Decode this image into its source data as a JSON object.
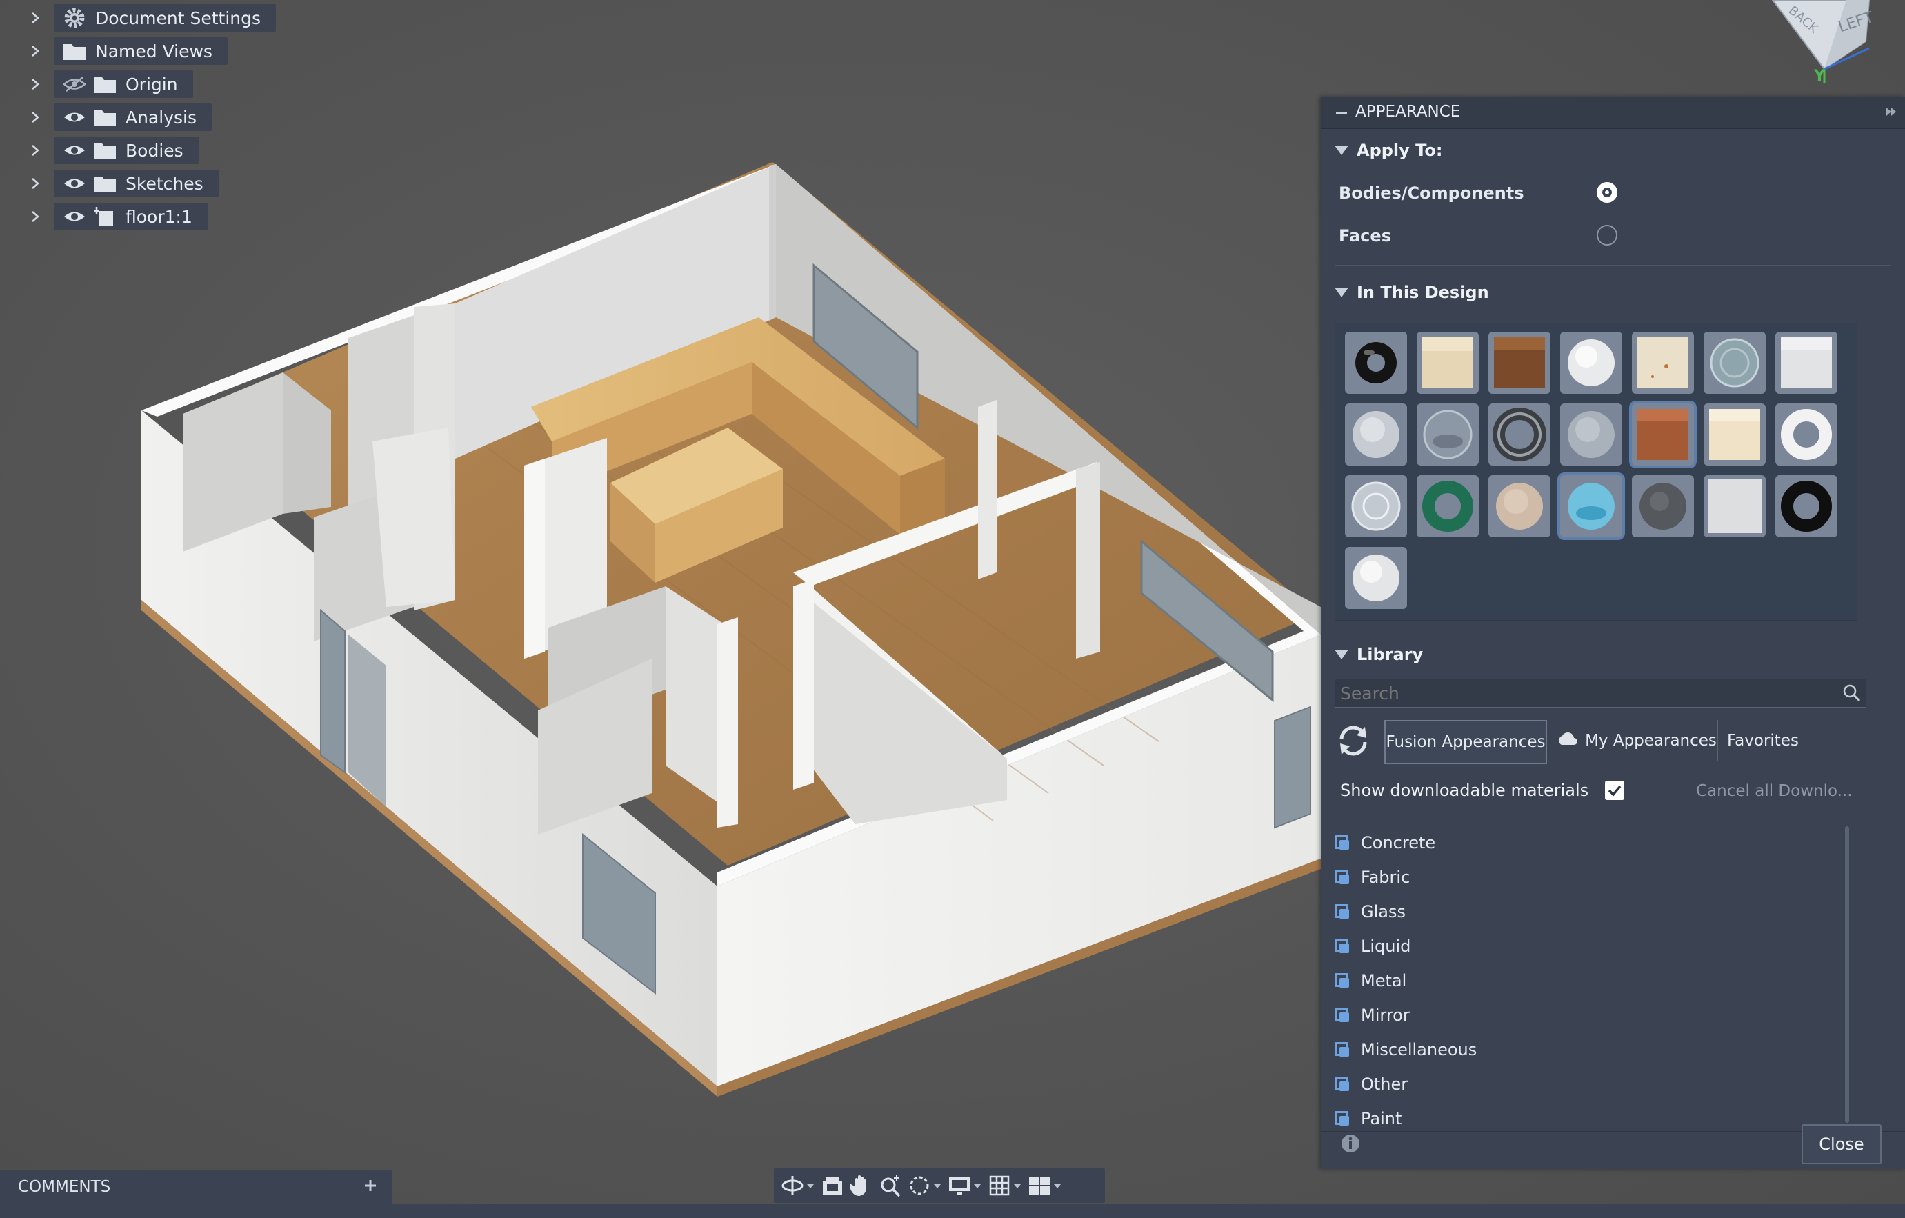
{
  "browser": {
    "items": [
      {
        "label": "Document Settings",
        "icon": "gear-icon"
      },
      {
        "label": "Named Views",
        "icon": "folder-icon"
      },
      {
        "label": "Origin",
        "icon": "folder-icon",
        "visibility": "hidden"
      },
      {
        "label": "Analysis",
        "icon": "folder-icon",
        "visibility": "visible"
      },
      {
        "label": "Bodies",
        "icon": "folder-icon",
        "visibility": "visible"
      },
      {
        "label": "Sketches",
        "icon": "folder-icon",
        "visibility": "visible"
      },
      {
        "label": "floor1:1",
        "icon": "component-icon",
        "visibility": "visible"
      }
    ]
  },
  "viewcube": {
    "left_face": "LEFT",
    "back_face": "BACK",
    "axis": "Y"
  },
  "appearance": {
    "title": "APPEARANCE",
    "apply_to": {
      "title": "Apply To:",
      "options": [
        {
          "label": "Bodies/Components",
          "selected": true
        },
        {
          "label": "Faces",
          "selected": false
        }
      ]
    },
    "in_this_design": {
      "title": "In This Design",
      "swatches": [
        "black-gloss-torus",
        "light-wood-cube",
        "walnut-wood-cube",
        "white-sphere",
        "speckled-wood-cube",
        "glass-sphere",
        "white-marble-cube",
        "frosted-sphere",
        "clear-glass-sphere",
        "chrome-torus",
        "matte-grey-sphere",
        "cherry-wood-cube",
        "birch-wood-cube",
        "white-torus",
        "clear-sphere",
        "green-torus",
        "sandstone-sphere",
        "blue-glass-sphere",
        "granite-sphere",
        "white-plaster-cube",
        "black-torus",
        "white-sphere-2"
      ],
      "selected_index": [
        11,
        17
      ]
    },
    "library": {
      "title": "Library",
      "search_placeholder": "Search",
      "tabs": [
        "Fusion Appearances",
        "My Appearances",
        "Favorites"
      ],
      "active_tab": "Fusion Appearances",
      "show_downloadable_label": "Show downloadable materials",
      "show_downloadable_checked": true,
      "cancel_downloads": "Cancel all Downlo...",
      "categories": [
        "Concrete",
        "Fabric",
        "Glass",
        "Liquid",
        "Metal",
        "Mirror",
        "Miscellaneous",
        "Other",
        "Paint"
      ]
    },
    "close_label": "Close"
  },
  "comments": {
    "label": "COMMENTS"
  },
  "colors": {
    "panel": "#3b4352",
    "accent": "#6fa3e0",
    "wood": "#c89a5e",
    "wall": "#e6e6e4"
  }
}
